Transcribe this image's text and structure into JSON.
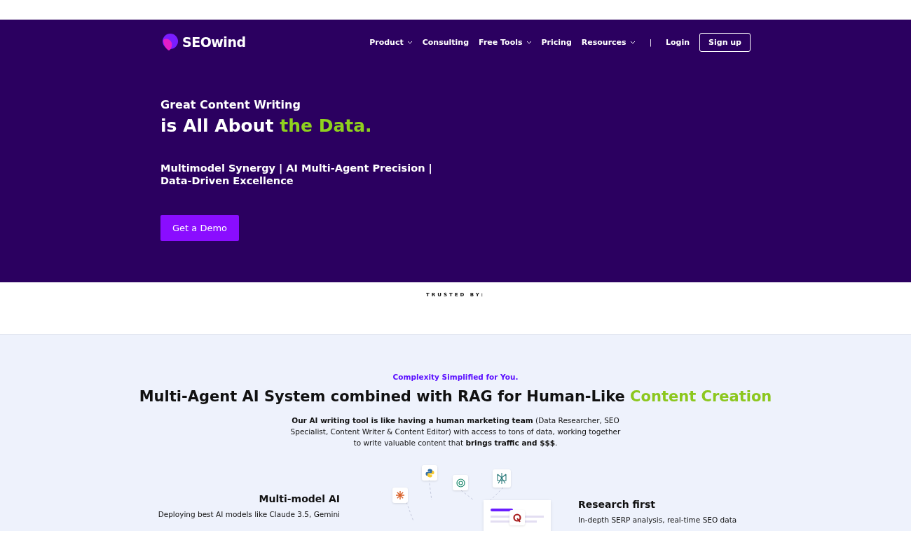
{
  "header": {
    "logo": "SEOwind",
    "nav": [
      {
        "label": "Product",
        "dropdown": true
      },
      {
        "label": "Consulting",
        "dropdown": false
      },
      {
        "label": "Free Tools",
        "dropdown": true
      },
      {
        "label": "Pricing",
        "dropdown": false
      },
      {
        "label": "Resources",
        "dropdown": true
      }
    ],
    "separator": "|",
    "login": "Login",
    "signup": "Sign up"
  },
  "hero": {
    "eyebrow": "Great Content Writing",
    "headline": "is All About ",
    "headline_accent": "the Data.",
    "subtitle": "Multimodel Synergy | AI Multi-Agent Precision | Data-Driven Excellence",
    "cta": "Get a Demo"
  },
  "trusted": {
    "label": "TRUSTED BY:"
  },
  "features": {
    "kicker": "Complexity Simplified for You.",
    "title": "Multi-Agent AI System combined with RAG for Human-Like ",
    "title_accent": "Content Creation",
    "description": "**Our AI writing tool is like having a human marketing team** (Data Researcher, SEO Specialist, Content Writer & Content Editor) with access to tons of data, working together to write valuable content that **brings traffic and $$$**.",
    "left": {
      "title": "Multi-model AI",
      "text": "Deploying best AI models like Claude 3.5, Gemini"
    },
    "right": {
      "title": "Research first",
      "text": "In-depth SERP analysis, real-time SEO data"
    }
  }
}
